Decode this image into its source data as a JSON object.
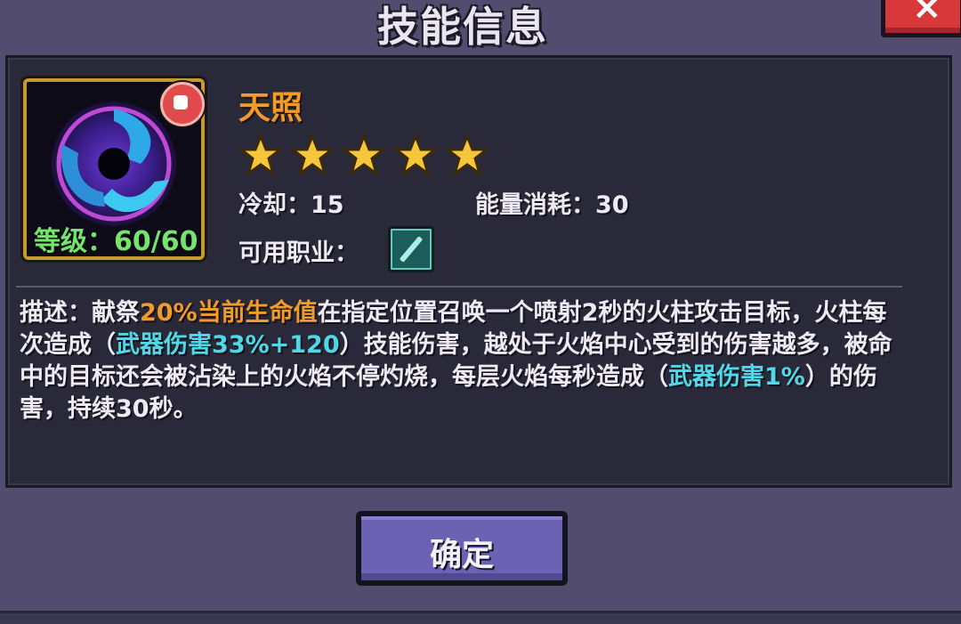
{
  "dialog": {
    "title": "技能信息",
    "close_icon": "close-icon"
  },
  "skill": {
    "name": "天照",
    "level_text": "等级：60/60",
    "stars": 5,
    "cooldown_label": "冷却：15",
    "energy_label": "能量消耗：30",
    "job_label": "可用职业：",
    "icon": "dark-vortex-skill-icon",
    "element_badge": "fire-element-icon",
    "job_icon": "sword-class-icon"
  },
  "description": {
    "prefix": "描述：献祭",
    "hl1": "20%当前生命值",
    "part2": "在指定位置召唤一个喷射2秒的火柱攻击目标，火柱每次造成（",
    "hl2": "武器伤害33%+120",
    "part3": "）技能伤害，越处于火焰中心受到的伤害越多，被命中的目标还会被沾染上的火焰不停灼烧，每层火焰每秒造成（",
    "hl3": "武器伤害1%",
    "part4": "）的伤害，持续30秒。"
  },
  "buttons": {
    "confirm": "确定"
  },
  "colors": {
    "name": "#f29a2a",
    "level": "#75e36d",
    "highlight_orange": "#f29a2a",
    "highlight_cyan": "#4fd9e8",
    "button": "#6b62b4"
  }
}
